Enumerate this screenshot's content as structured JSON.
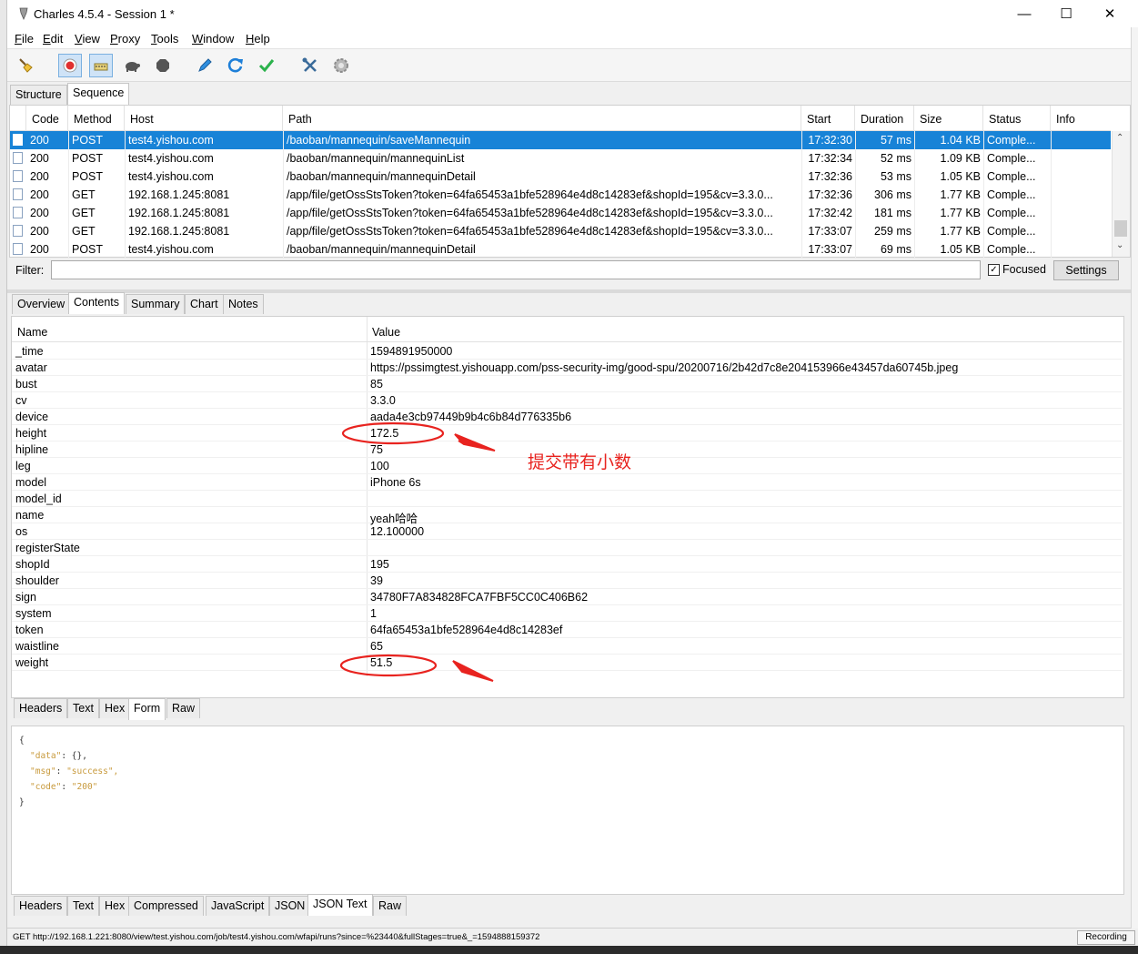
{
  "window": {
    "title": "Charles 4.5.4 - Session 1 *",
    "minimize": "—",
    "maximize": "☐",
    "close": "✕"
  },
  "menu": [
    "File",
    "Edit",
    "View",
    "Proxy",
    "Tools",
    "Window",
    "Help"
  ],
  "view_tabs": [
    "Structure",
    "Sequence"
  ],
  "columns": [
    "Code",
    "Method",
    "Host",
    "Path",
    "Start",
    "Duration",
    "Size",
    "Status",
    "Info"
  ],
  "rows": [
    {
      "code": "200",
      "method": "POST",
      "host": "test4.yishou.com",
      "path": "/baoban/mannequin/saveMannequin",
      "start": "17:32:30",
      "duration": "57 ms",
      "size": "1.04 KB",
      "status": "Comple...",
      "info": "",
      "selected": true
    },
    {
      "code": "200",
      "method": "POST",
      "host": "test4.yishou.com",
      "path": "/baoban/mannequin/mannequinList",
      "start": "17:32:34",
      "duration": "52 ms",
      "size": "1.09 KB",
      "status": "Comple...",
      "info": "",
      "selected": false
    },
    {
      "code": "200",
      "method": "POST",
      "host": "test4.yishou.com",
      "path": "/baoban/mannequin/mannequinDetail",
      "start": "17:32:36",
      "duration": "53 ms",
      "size": "1.05 KB",
      "status": "Comple...",
      "info": "",
      "selected": false
    },
    {
      "code": "200",
      "method": "GET",
      "host": "192.168.1.245:8081",
      "path": "/app/file/getOssStsToken?token=64fa65453a1bfe528964e4d8c14283ef&shopId=195&cv=3.3.0...",
      "start": "17:32:36",
      "duration": "306 ms",
      "size": "1.77 KB",
      "status": "Comple...",
      "info": "",
      "selected": false
    },
    {
      "code": "200",
      "method": "GET",
      "host": "192.168.1.245:8081",
      "path": "/app/file/getOssStsToken?token=64fa65453a1bfe528964e4d8c14283ef&shopId=195&cv=3.3.0...",
      "start": "17:32:42",
      "duration": "181 ms",
      "size": "1.77 KB",
      "status": "Comple...",
      "info": "",
      "selected": false
    },
    {
      "code": "200",
      "method": "GET",
      "host": "192.168.1.245:8081",
      "path": "/app/file/getOssStsToken?token=64fa65453a1bfe528964e4d8c14283ef&shopId=195&cv=3.3.0...",
      "start": "17:33:07",
      "duration": "259 ms",
      "size": "1.77 KB",
      "status": "Comple...",
      "info": "",
      "selected": false
    },
    {
      "code": "200",
      "method": "POST",
      "host": "test4.yishou.com",
      "path": "/baoban/mannequin/mannequinDetail",
      "start": "17:33:07",
      "duration": "69 ms",
      "size": "1.05 KB",
      "status": "Comple...",
      "info": "",
      "selected": false
    }
  ],
  "filter": {
    "label": "Filter:",
    "value": "",
    "focused_label": "Focused",
    "focused_checked": true,
    "settings_label": "Settings"
  },
  "detail_tabs": [
    "Overview",
    "Contents",
    "Summary",
    "Chart",
    "Notes"
  ],
  "form_headers": {
    "name": "Name",
    "value": "Value"
  },
  "form_fields": [
    {
      "name": "_time",
      "value": "1594891950000"
    },
    {
      "name": "avatar",
      "value": "https://pssimgtest.yishouapp.com/pss-security-img/good-spu/20200716/2b42d7c8e204153966e43457da60745b.jpeg"
    },
    {
      "name": "bust",
      "value": "85"
    },
    {
      "name": "cv",
      "value": "3.3.0"
    },
    {
      "name": "device",
      "value": "aada4e3cb97449b9b4c6b84d776335b6"
    },
    {
      "name": "height",
      "value": "172.5"
    },
    {
      "name": "hipline",
      "value": "75"
    },
    {
      "name": "leg",
      "value": "100"
    },
    {
      "name": "model",
      "value": "iPhone 6s"
    },
    {
      "name": "model_id",
      "value": ""
    },
    {
      "name": "name",
      "value": "yeah哈哈"
    },
    {
      "name": "os",
      "value": "12.100000"
    },
    {
      "name": "registerState",
      "value": ""
    },
    {
      "name": "shopId",
      "value": "195"
    },
    {
      "name": "shoulder",
      "value": "39"
    },
    {
      "name": "sign",
      "value": "34780F7A834828FCA7FBF5CC0C406B62"
    },
    {
      "name": "system",
      "value": "1"
    },
    {
      "name": "token",
      "value": "64fa65453a1bfe528964e4d8c14283ef"
    },
    {
      "name": "waistline",
      "value": "65"
    },
    {
      "name": "weight",
      "value": "51.5"
    }
  ],
  "request_tabs": [
    "Headers",
    "Text",
    "Hex",
    "Form",
    "Raw"
  ],
  "response_json": {
    "open": "{",
    "lines": [
      {
        "key": "\"data\"",
        "value": "{},"
      },
      {
        "key": "\"msg\"",
        "value": "\"success\","
      },
      {
        "key": "\"code\"",
        "value": "\"200\""
      }
    ],
    "close": "}"
  },
  "response_tabs": [
    "Headers",
    "Text",
    "Hex",
    "Compressed",
    "JavaScript",
    "JSON",
    "JSON Text",
    "Raw"
  ],
  "status_bar": {
    "text": "GET http://192.168.1.221:8080/view/test.yishou.com/job/test4.yishou.com/wfapi/runs?since=%23440&fullStages=true&_=1594888159372",
    "recording": "Recording"
  },
  "annotation": {
    "text": "提交带有小数",
    "color": "#e8231f"
  },
  "colors": {
    "selection": "#1883d7",
    "record": "#e03030",
    "ok": "#2bb24c",
    "refresh": "#1e7fd8"
  }
}
